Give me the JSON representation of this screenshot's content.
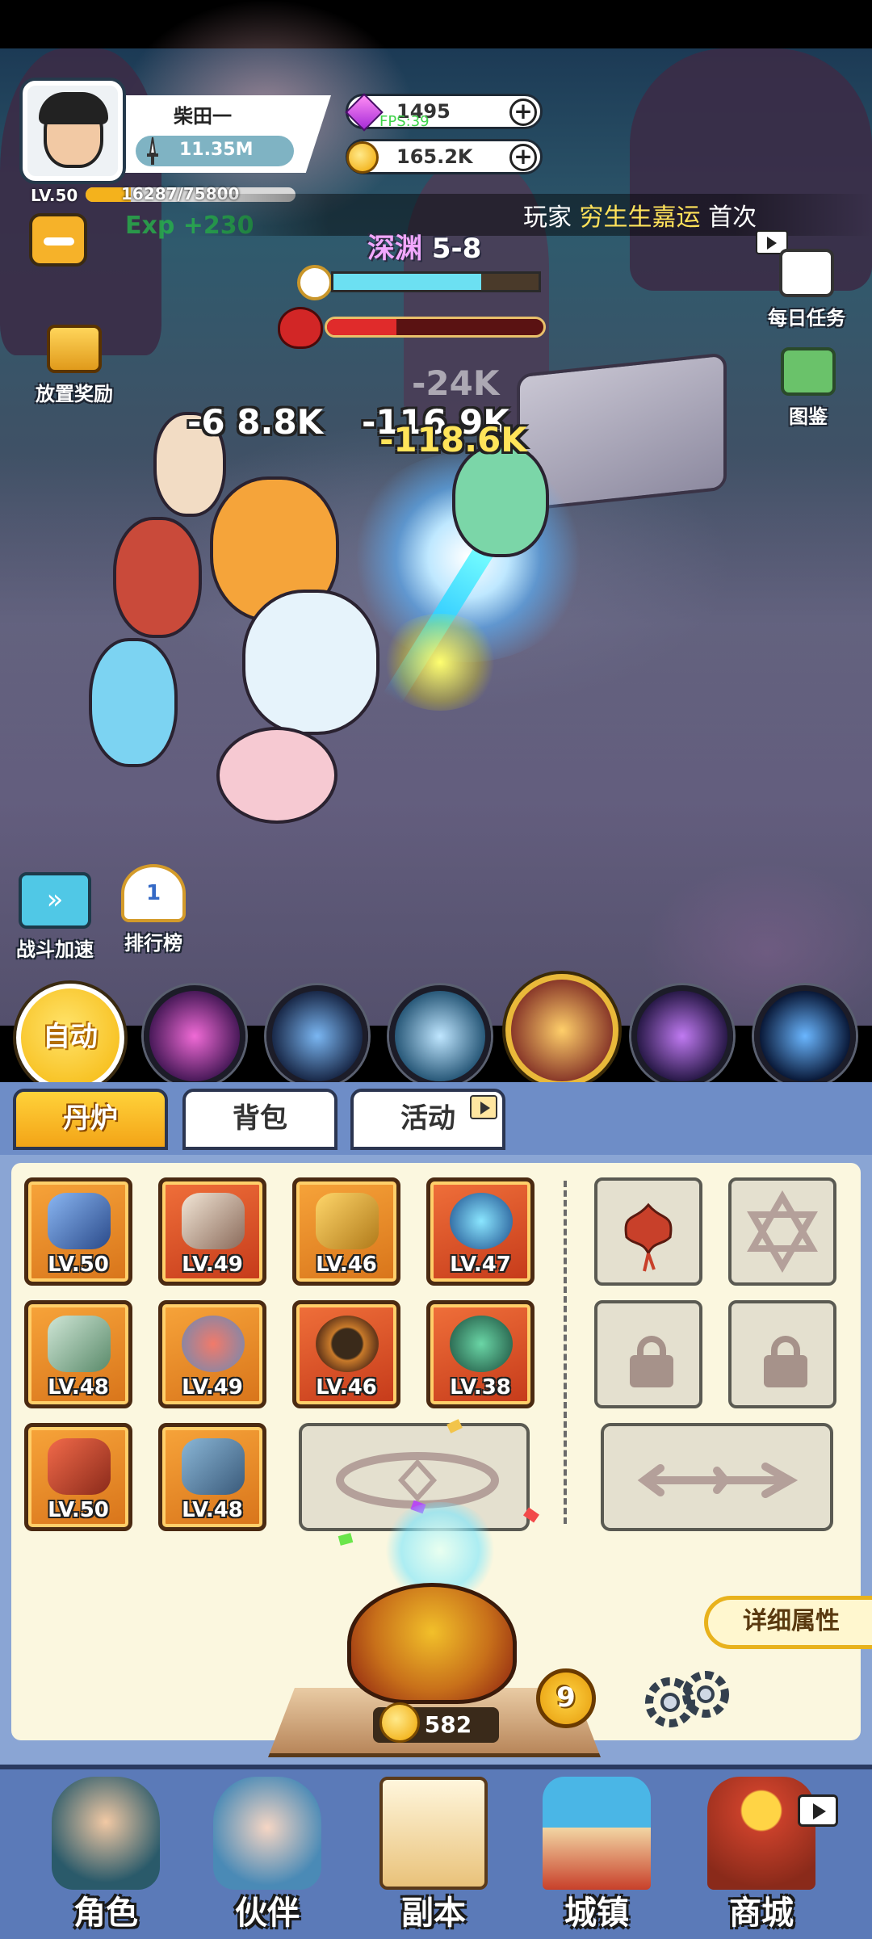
{
  "player": {
    "name": "柴田一",
    "power": "11.35M",
    "level": "LV.50",
    "exp_text": "16287/75800",
    "exp_fraction": 0.215,
    "exp_gain": "Exp +230"
  },
  "currency": {
    "gems": "1495",
    "coins": "165.2K"
  },
  "fps_overlay": "FPS:39",
  "broadcast": {
    "prefix": "玩家",
    "name": "穷生生嘉运",
    "suffix": "首次"
  },
  "stage": {
    "zone": "深渊",
    "number": "5-8",
    "timer_fraction": 0.72,
    "boss_hp_fraction": 0.32
  },
  "damage_numbers": [
    "-6 8.8K",
    "-116.9K",
    "-118.6K",
    "-24K"
  ],
  "left_hud": {
    "idle_reward": "放置奖励",
    "battle_speed": "战斗加速",
    "leaderboard": "排行榜"
  },
  "right_hud": {
    "daily_tasks": "每日任务",
    "codex": "图鉴"
  },
  "skills": {
    "auto": "自动",
    "icons": [
      "purple-vortex-skill-icon",
      "lightning-card-skill-icon",
      "qilin-summon-skill-icon",
      "beast-ultimate-skill-icon",
      "dark-swirl-skill-icon",
      "blue-comet-skill-icon"
    ]
  },
  "tabs": [
    "丹炉",
    "背包",
    "活动"
  ],
  "equipment": [
    {
      "icon": "spear-icon",
      "level": "LV.50",
      "color": "#e0821c"
    },
    {
      "icon": "horned-helmet-icon",
      "level": "LV.49",
      "color": "#d84a22"
    },
    {
      "icon": "armor-icon",
      "level": "LV.46",
      "color": "#e0821c"
    },
    {
      "icon": "orb-icon",
      "level": "LV.47",
      "color": "#d84a22"
    },
    {
      "icon": "fan-icon",
      "level": "LV.48",
      "color": "#e0821c"
    },
    {
      "icon": "shield-icon",
      "level": "LV.49",
      "color": "#e0821c"
    },
    {
      "icon": "beads-bracelet-icon",
      "level": "LV.46",
      "color": "#d84a22"
    },
    {
      "icon": "jade-pendant-icon",
      "level": "LV.38",
      "color": "#d84a22"
    },
    {
      "icon": "belt-icon",
      "level": "LV.50",
      "color": "#e0821c"
    },
    {
      "icon": "boots-icon",
      "level": "LV.48",
      "color": "#e0821c"
    }
  ],
  "special_slots": [
    "flame-flower-icon",
    "hexagram-icon",
    "lock-icon",
    "lock-icon"
  ],
  "detail_attributes": "详细属性",
  "furnace": {
    "count": "582",
    "level": "9"
  },
  "nav": [
    "角色",
    "伙伴",
    "副本",
    "城镇",
    "商城"
  ],
  "colors": {
    "accent_gold": "#f5b60a",
    "panel_blue": "#8aa5d4",
    "panel_cream": "#fbf7df",
    "hp_red": "#e02b2b",
    "timer_cyan": "#6ce0f2"
  }
}
